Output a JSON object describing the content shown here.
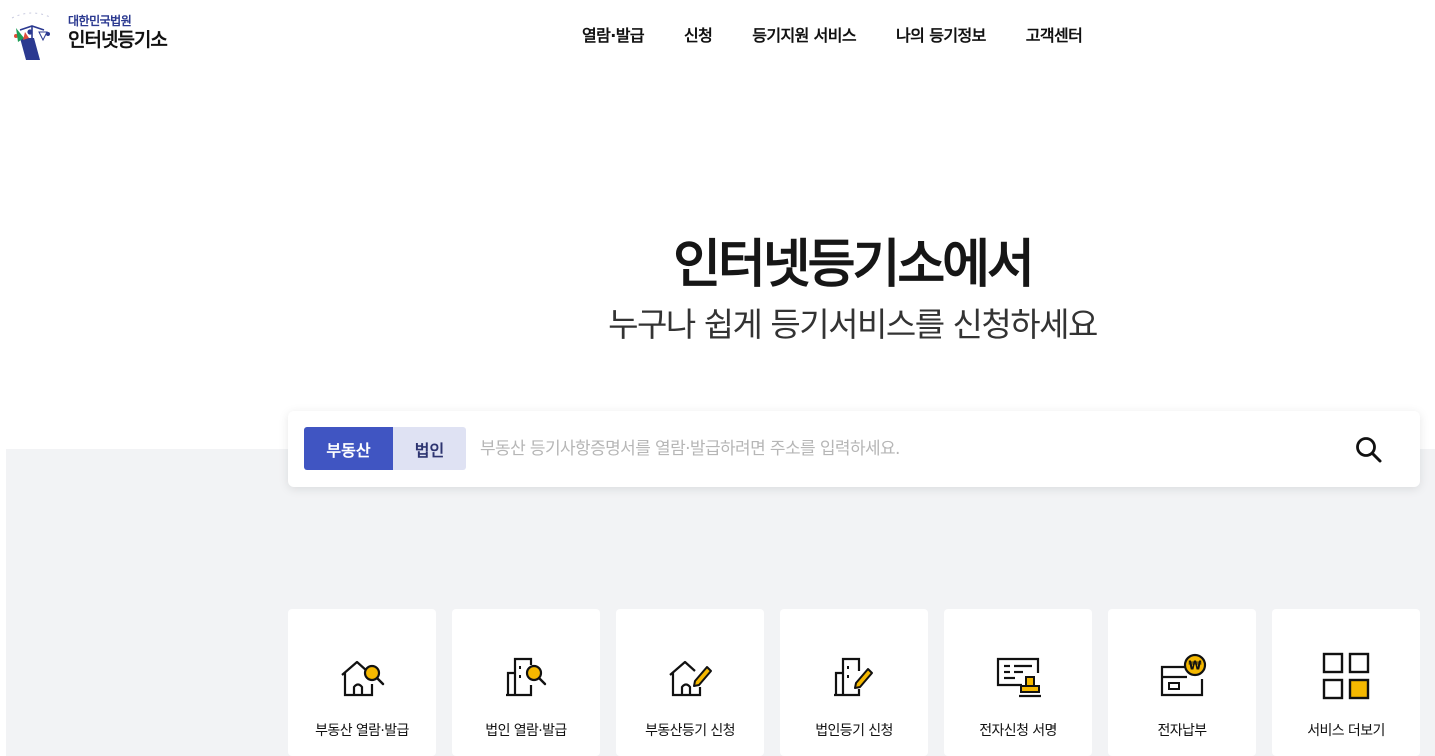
{
  "header": {
    "logo_sub": "대한민국법원",
    "logo_main": "인터넷등기소",
    "nav": [
      "열람·발급",
      "신청",
      "등기지원 서비스",
      "나의 등기정보",
      "고객센터"
    ]
  },
  "hero": {
    "title": "인터넷등기소에서",
    "subtitle": "누구나 쉽게 등기서비스를 신청하세요"
  },
  "search": {
    "tabs": [
      "부동산",
      "법인"
    ],
    "active_tab": "부동산",
    "placeholder": "부동산 등기사항증명서를 열람·발급하려면 주소를 입력하세요.",
    "value": ""
  },
  "services": [
    {
      "label": "부동산 열람·발급",
      "icon": "house-search-icon"
    },
    {
      "label": "법인 열람·발급",
      "icon": "building-search-icon"
    },
    {
      "label": "부동산등기 신청",
      "icon": "house-pen-icon"
    },
    {
      "label": "법인등기 신청",
      "icon": "building-pen-icon"
    },
    {
      "label": "전자신청 서명",
      "icon": "document-stamp-icon"
    },
    {
      "label": "전자납부",
      "icon": "card-won-icon"
    },
    {
      "label": "서비스 더보기",
      "icon": "grid-more-icon"
    }
  ],
  "colors": {
    "accent": "#4055c2",
    "accent_light": "#dfe2f3",
    "icon_yellow": "#f5b800",
    "background_gray": "#f2f3f5"
  }
}
